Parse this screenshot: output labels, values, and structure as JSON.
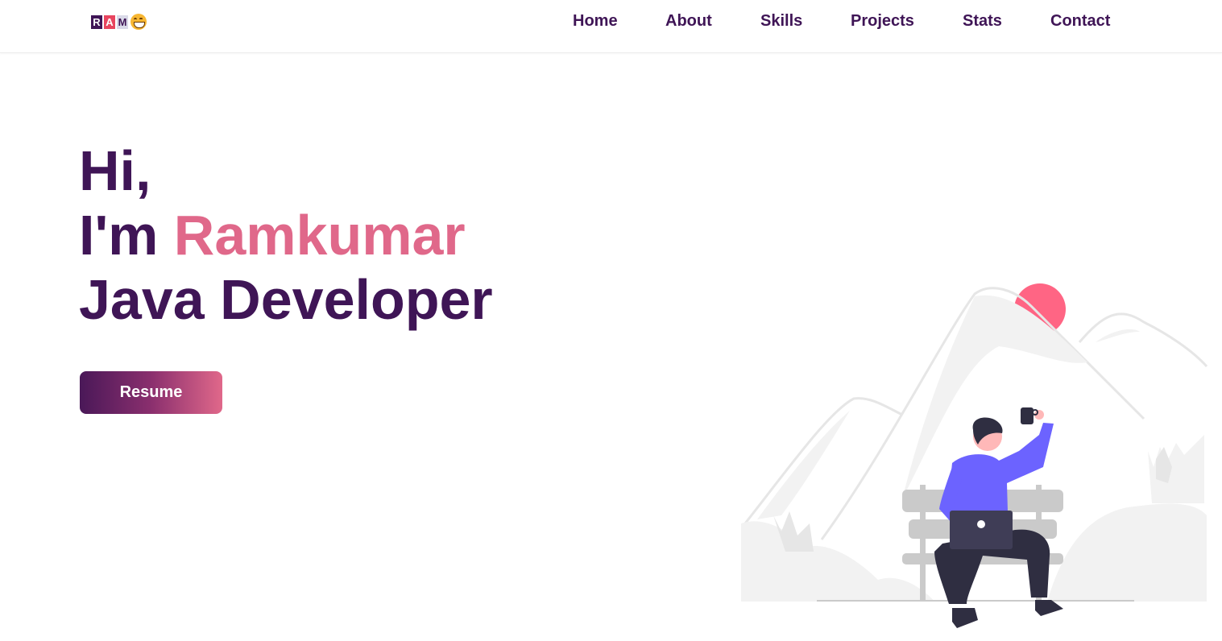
{
  "nav": {
    "logo_letters": [
      "R",
      "A",
      "M"
    ],
    "logo_emoji": "grinning-face-emoji",
    "links": [
      "Home",
      "About",
      "Skills",
      "Projects",
      "Stats",
      "Contact"
    ]
  },
  "hero": {
    "greeting": "Hi,",
    "intro_prefix": "I'm ",
    "name": "Ramkumar",
    "role": "Java Developer",
    "resume_label": "Resume"
  },
  "colors": {
    "primary": "#3f1556",
    "accent": "#e0688a",
    "sun": "#ff6584",
    "figure_shirt": "#6c63ff",
    "figure_dark": "#2f2e41"
  },
  "illustration": {
    "icon": "person-on-bench-with-laptop-illustration"
  }
}
